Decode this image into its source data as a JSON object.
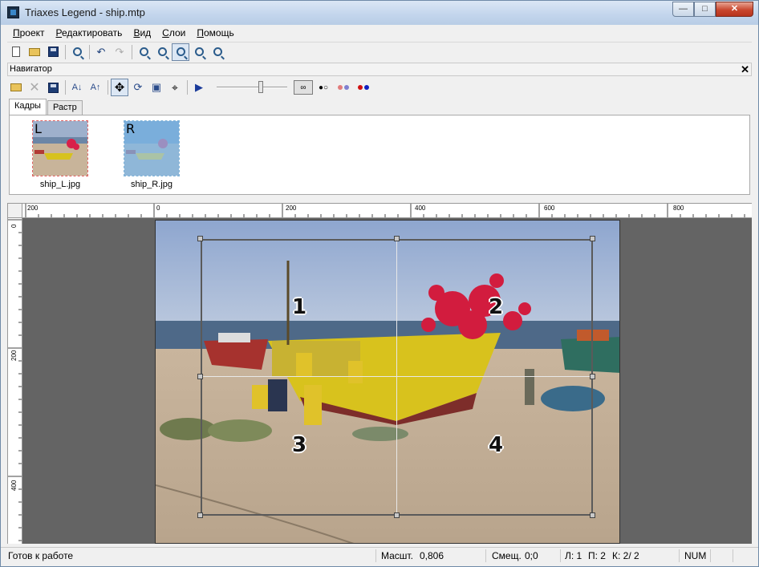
{
  "window": {
    "title": "Triaxes Legend - ship.mtp"
  },
  "menu": [
    "Проект",
    "Редактировать",
    "Вид",
    "Слои",
    "Помощь"
  ],
  "navigator": {
    "title": "Навигатор",
    "tabs": [
      "Кадры",
      "Растр"
    ],
    "frames": [
      {
        "letter": "L",
        "name": "ship_L.jpg"
      },
      {
        "letter": "R",
        "name": "ship_R.jpg"
      }
    ]
  },
  "rulers": {
    "h_labels": [
      "200",
      "0",
      "200",
      "400",
      "600",
      "800"
    ],
    "v_labels": [
      "0",
      "200",
      "400"
    ]
  },
  "grid": {
    "zones": [
      "1",
      "2",
      "3",
      "4"
    ]
  },
  "status": {
    "ready": "Готов к работе",
    "scale_label": "Масшт.",
    "scale_value": "0,806",
    "offset_label": "Смещ.",
    "offset_value": "0;0",
    "layer": "Л: 1",
    "pass": "П: 2",
    "frame": "К: 2/ 2",
    "num": "NUM"
  },
  "icons": {
    "toolbar": [
      "new-document-icon",
      "open-folder-icon",
      "save-icon",
      "print-preview-icon",
      "undo-icon",
      "redo-icon",
      "zoom-in-icon",
      "zoom-out-icon",
      "zoom-fit-icon",
      "zoom-region-icon",
      "zoom-actual-icon"
    ],
    "nav_toolbar": [
      "open-frames-icon",
      "delete-icon",
      "save-frames-icon",
      "sort-ascending-icon",
      "sort-descending-icon",
      "move-icon",
      "rotate-icon",
      "resize-icon",
      "crop-icon",
      "play-icon"
    ]
  }
}
